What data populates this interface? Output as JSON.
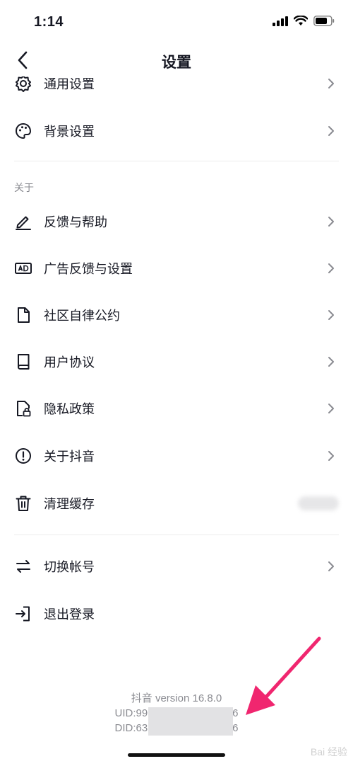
{
  "status_bar": {
    "time": "1:14"
  },
  "nav": {
    "title": "设置"
  },
  "items_top": [
    {
      "label": "通用设置",
      "icon": "gear-icon"
    },
    {
      "label": "背景设置",
      "icon": "palette-icon"
    }
  ],
  "about": {
    "header": "关于",
    "items": [
      {
        "label": "反馈与帮助",
        "icon": "pencil-icon"
      },
      {
        "label": "广告反馈与设置",
        "icon": "ad-icon"
      },
      {
        "label": "社区自律公约",
        "icon": "document-icon"
      },
      {
        "label": "用户协议",
        "icon": "book-icon"
      },
      {
        "label": "隐私政策",
        "icon": "lock-file-icon"
      },
      {
        "label": "关于抖音",
        "icon": "info-icon"
      },
      {
        "label": "清理缓存",
        "icon": "trash-icon"
      }
    ]
  },
  "account": [
    {
      "label": "切换帐号",
      "icon": "swap-icon"
    },
    {
      "label": "退出登录",
      "icon": "logout-icon"
    }
  ],
  "footer": {
    "version": "抖音 version 16.8.0",
    "uid_prefix": "UID:99",
    "uid_suffix": "6",
    "did_prefix": "DID:63",
    "did_suffix": "6"
  },
  "watermark": "Bai 经验",
  "colors": {
    "text": "#161823",
    "secondary": "#8a8b91",
    "arrow": "#f0266f"
  }
}
